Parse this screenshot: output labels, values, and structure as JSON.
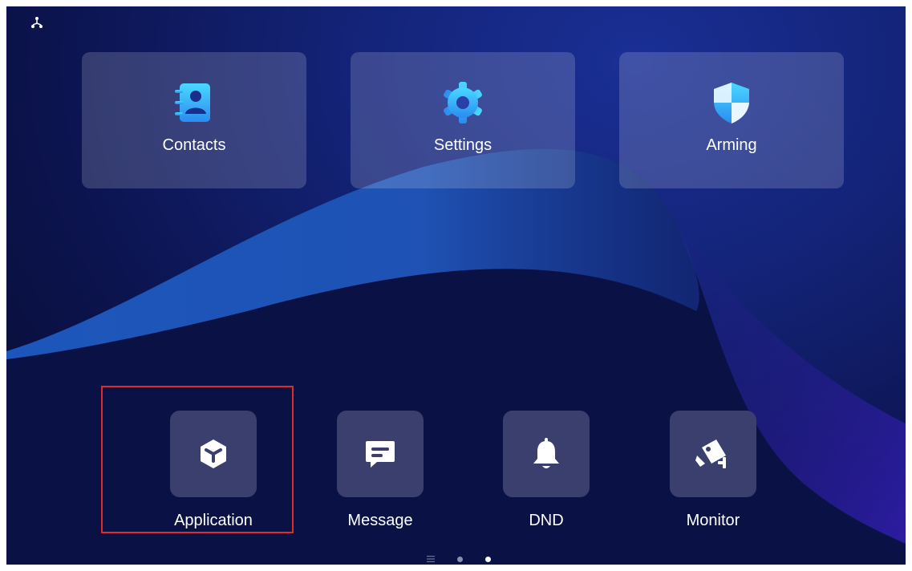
{
  "tiles": [
    {
      "name": "contacts",
      "label": "Contacts",
      "icon": "contacts-book-icon"
    },
    {
      "name": "settings",
      "label": "Settings",
      "icon": "gear-icon"
    },
    {
      "name": "arming",
      "label": "Arming",
      "icon": "shield-icon"
    }
  ],
  "dock": [
    {
      "name": "application",
      "label": "Application",
      "icon": "cube-icon"
    },
    {
      "name": "message",
      "label": "Message",
      "icon": "chat-bubble-icon"
    },
    {
      "name": "dnd",
      "label": "DND",
      "icon": "bell-icon"
    },
    {
      "name": "monitor",
      "label": "Monitor",
      "icon": "security-camera-icon"
    }
  ],
  "status": {
    "icon": "network-icon"
  },
  "pager": {
    "pages": 2,
    "active_page": 2
  },
  "colors": {
    "tile_icon_gradient": [
      "#4ad8ff",
      "#2a8cf0"
    ],
    "dock_box": "#3a3f6e",
    "highlight_border": "#e02b2b",
    "label": "#ffffff"
  }
}
